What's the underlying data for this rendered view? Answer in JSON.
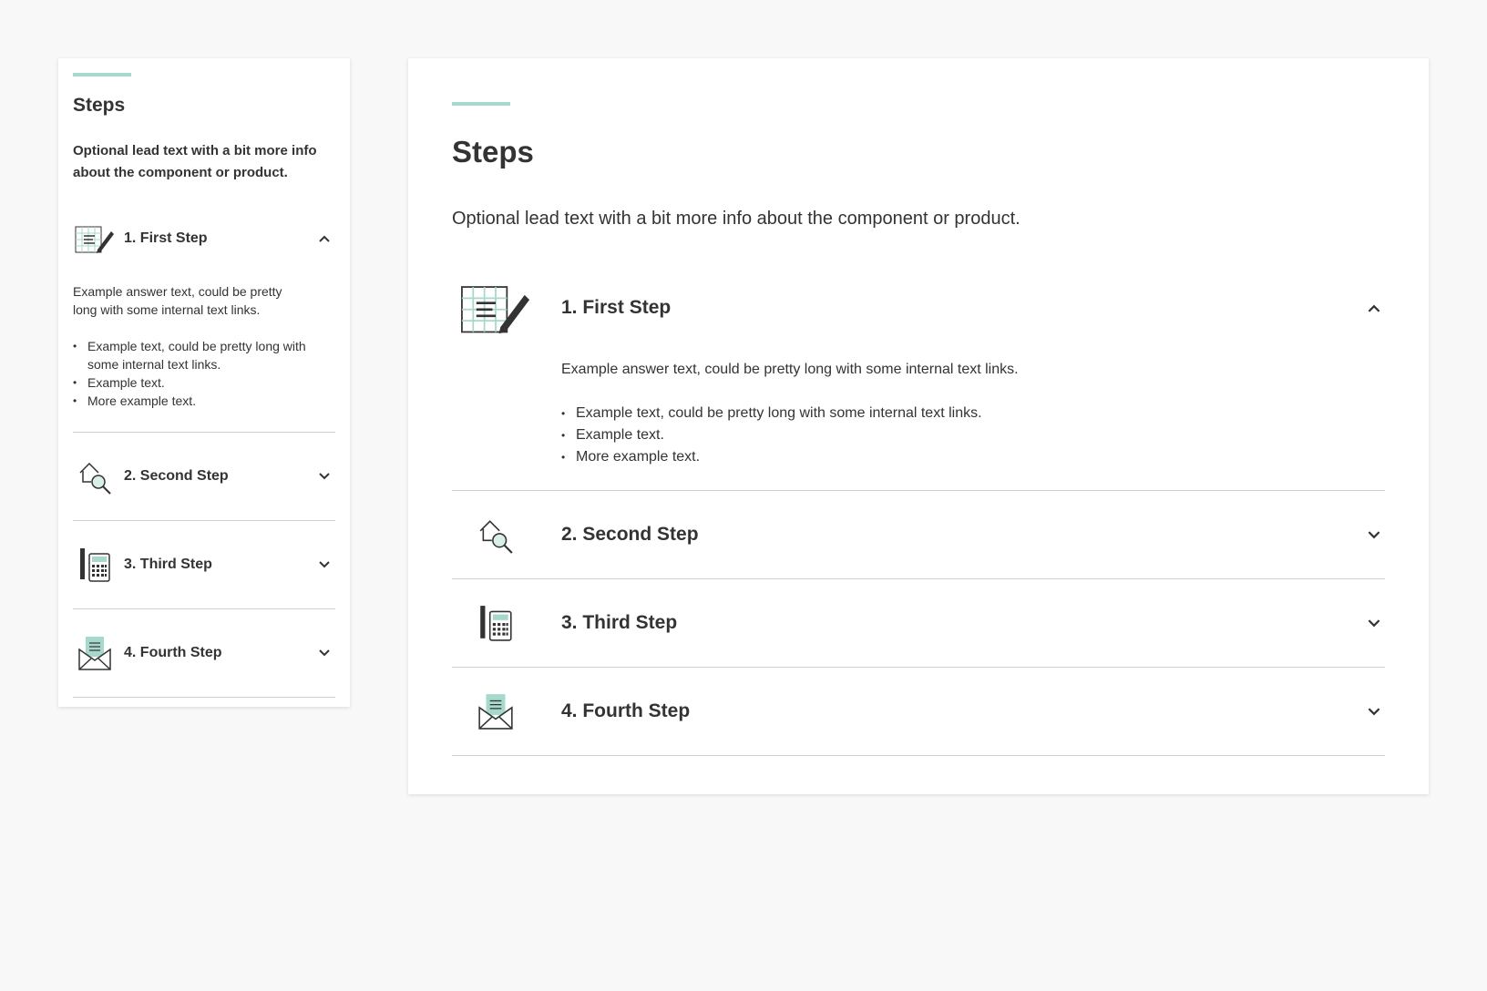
{
  "component": {
    "title": "Steps",
    "lead": "Optional lead text with a bit more info about the component or product.",
    "steps": [
      {
        "label": "1. First Step",
        "icon": "form-pencil-icon",
        "expanded": true,
        "answer": "Example answer text, could be pretty long with some internal text links.",
        "bullets": [
          "Example text, could be pretty long with some internal text links.",
          "Example text.",
          "More example text."
        ]
      },
      {
        "label": "2. Second Step",
        "icon": "house-search-icon",
        "expanded": false
      },
      {
        "label": "3. Third Step",
        "icon": "pencil-calculator-icon",
        "expanded": false
      },
      {
        "label": "4. Fourth Step",
        "icon": "envelope-letter-icon",
        "expanded": false
      }
    ]
  },
  "colors": {
    "accent": "#a7d8cc",
    "text": "#333333",
    "divider": "#cfcfcf",
    "background": "#f8f8f8"
  }
}
